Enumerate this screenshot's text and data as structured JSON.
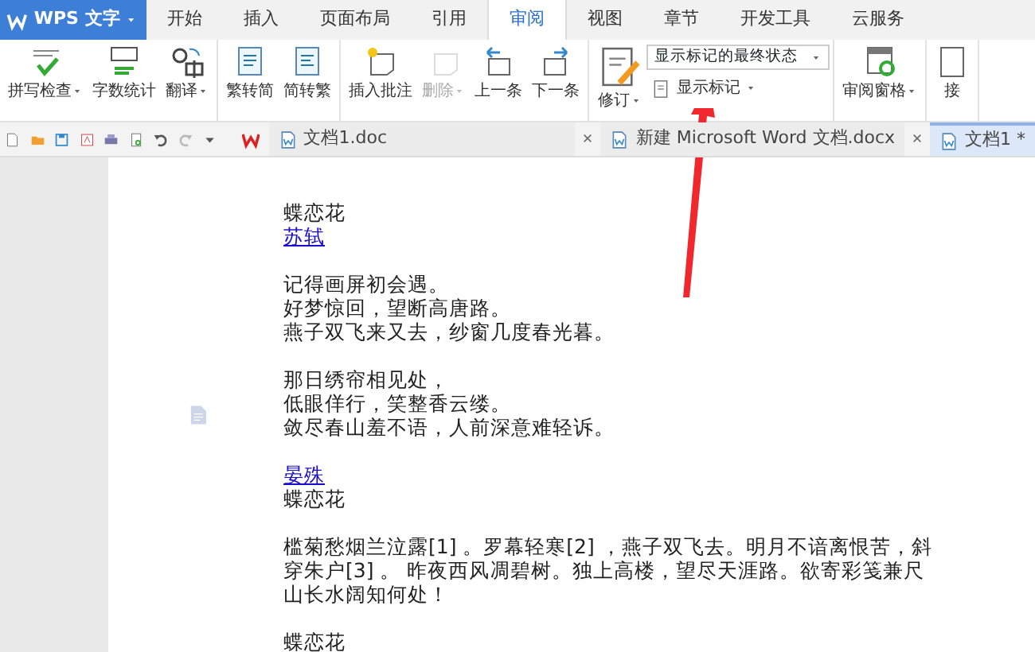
{
  "app": {
    "title": "WPS 文字"
  },
  "tabs": [
    {
      "label": "开始",
      "selected": false
    },
    {
      "label": "插入",
      "selected": false
    },
    {
      "label": "页面布局",
      "selected": false
    },
    {
      "label": "引用",
      "selected": false
    },
    {
      "label": "审阅",
      "selected": true
    },
    {
      "label": "视图",
      "selected": false
    },
    {
      "label": "章节",
      "selected": false
    },
    {
      "label": "开发工具",
      "selected": false
    },
    {
      "label": "云服务",
      "selected": false
    }
  ],
  "ribbon_groups": [
    {
      "items": [
        {
          "kind": "spell",
          "label": "拼写检查",
          "dropdown": true,
          "disabled": false
        },
        {
          "kind": "count",
          "label": "字数统计",
          "dropdown": false,
          "disabled": false
        },
        {
          "kind": "translate",
          "label": "翻译",
          "dropdown": true,
          "disabled": false
        }
      ]
    },
    {
      "items": [
        {
          "kind": "trad",
          "label": "繁转简",
          "dropdown": false,
          "disabled": false
        },
        {
          "kind": "simp",
          "label": "简转繁",
          "dropdown": false,
          "disabled": false
        }
      ]
    },
    {
      "items": [
        {
          "kind": "comment",
          "label": "插入批注",
          "dropdown": false,
          "disabled": false
        },
        {
          "kind": "delete",
          "label": "删除",
          "dropdown": true,
          "disabled": true
        },
        {
          "kind": "prev",
          "label": "上一条",
          "dropdown": false,
          "disabled": false
        },
        {
          "kind": "next",
          "label": "下一条",
          "dropdown": false,
          "disabled": false
        }
      ]
    },
    {
      "items": [
        {
          "kind": "revise",
          "label": "修订",
          "dropdown": true,
          "disabled": false
        },
        {
          "kind": "markup",
          "select_value": "显示标记的最终状态",
          "label": "显示标记",
          "dropdown": true,
          "disabled": false
        }
      ]
    },
    {
      "items": [
        {
          "kind": "pane",
          "label": "审阅窗格",
          "dropdown": true,
          "disabled": false
        }
      ]
    },
    {
      "items": [
        {
          "kind": "accept",
          "label": "接",
          "dropdown": false,
          "disabled": false
        }
      ]
    }
  ],
  "doc_tabs": [
    {
      "label": "文档1.doc",
      "selected": false,
      "closable": true
    },
    {
      "label": "新建 Microsoft Word 文档.docx",
      "selected": false,
      "closable": true
    },
    {
      "label": "文档1 *",
      "selected": true,
      "closable": false
    }
  ],
  "document": {
    "lines": [
      {
        "kind": "text",
        "text": "蝶恋花"
      },
      {
        "kind": "link",
        "text": "苏轼"
      },
      {
        "kind": "blank"
      },
      {
        "kind": "text",
        "text": "记得画屏初会遇。"
      },
      {
        "kind": "text",
        "text": "好梦惊回，望断高唐路。"
      },
      {
        "kind": "text",
        "text": "燕子双飞来又去，纱窗几度春光暮。"
      },
      {
        "kind": "blank"
      },
      {
        "kind": "text",
        "text": "那日绣帘相见处，"
      },
      {
        "kind": "text",
        "text": "低眼佯行，笑整香云缕。"
      },
      {
        "kind": "text",
        "text": "敛尽春山羞不语，人前深意难轻诉。"
      },
      {
        "kind": "blank"
      },
      {
        "kind": "link",
        "text": "晏殊"
      },
      {
        "kind": "text",
        "text": "蝶恋花"
      },
      {
        "kind": "blank"
      },
      {
        "kind": "text",
        "text": "槛菊愁烟兰泣露[1] 。罗幕轻寒[2] ，燕子双飞去。明月不谙离恨苦，斜"
      },
      {
        "kind": "text",
        "text": "穿朱户[3] 。 昨夜西风凋碧树。独上高楼，望尽天涯路。欲寄彩笺兼尺"
      },
      {
        "kind": "text",
        "text": "山长水阔知何处！"
      },
      {
        "kind": "blank"
      },
      {
        "kind": "text",
        "text": "蝶恋花"
      }
    ]
  }
}
